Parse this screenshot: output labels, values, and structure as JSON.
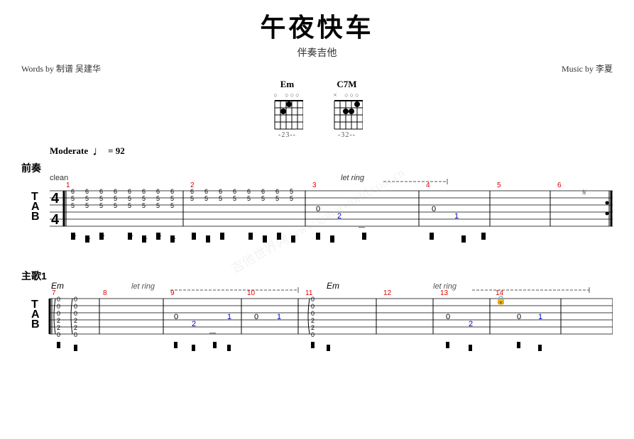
{
  "title": {
    "main": "午夜快车",
    "sub": "伴奏吉他",
    "words_by": "Words by 制谱 吴建华",
    "music_by": "Music by 李夏"
  },
  "chords": [
    {
      "name": "Em",
      "dots": "○  ○○○",
      "fret_numbers": "-23--",
      "grid": [
        [
          0,
          0,
          0
        ],
        [
          0,
          1,
          1
        ],
        [
          0,
          0,
          0
        ],
        [
          0,
          1,
          0
        ],
        [
          0,
          0,
          0
        ]
      ]
    },
    {
      "name": "C7M",
      "dots": "×  ○○○",
      "fret_numbers": "-32--",
      "grid": [
        [
          0,
          1,
          0
        ],
        [
          1,
          0,
          0
        ],
        [
          0,
          1,
          1
        ],
        [
          0,
          0,
          0
        ],
        [
          0,
          0,
          0
        ]
      ]
    }
  ],
  "tempo": {
    "label": "Moderate",
    "bpm": "= 92"
  },
  "sections": [
    {
      "label": "前奏",
      "annotation": "clean"
    },
    {
      "label": "主歌1",
      "annotation": ""
    }
  ],
  "watermark": "吉他世界网 www.guitarworld.com.cn"
}
